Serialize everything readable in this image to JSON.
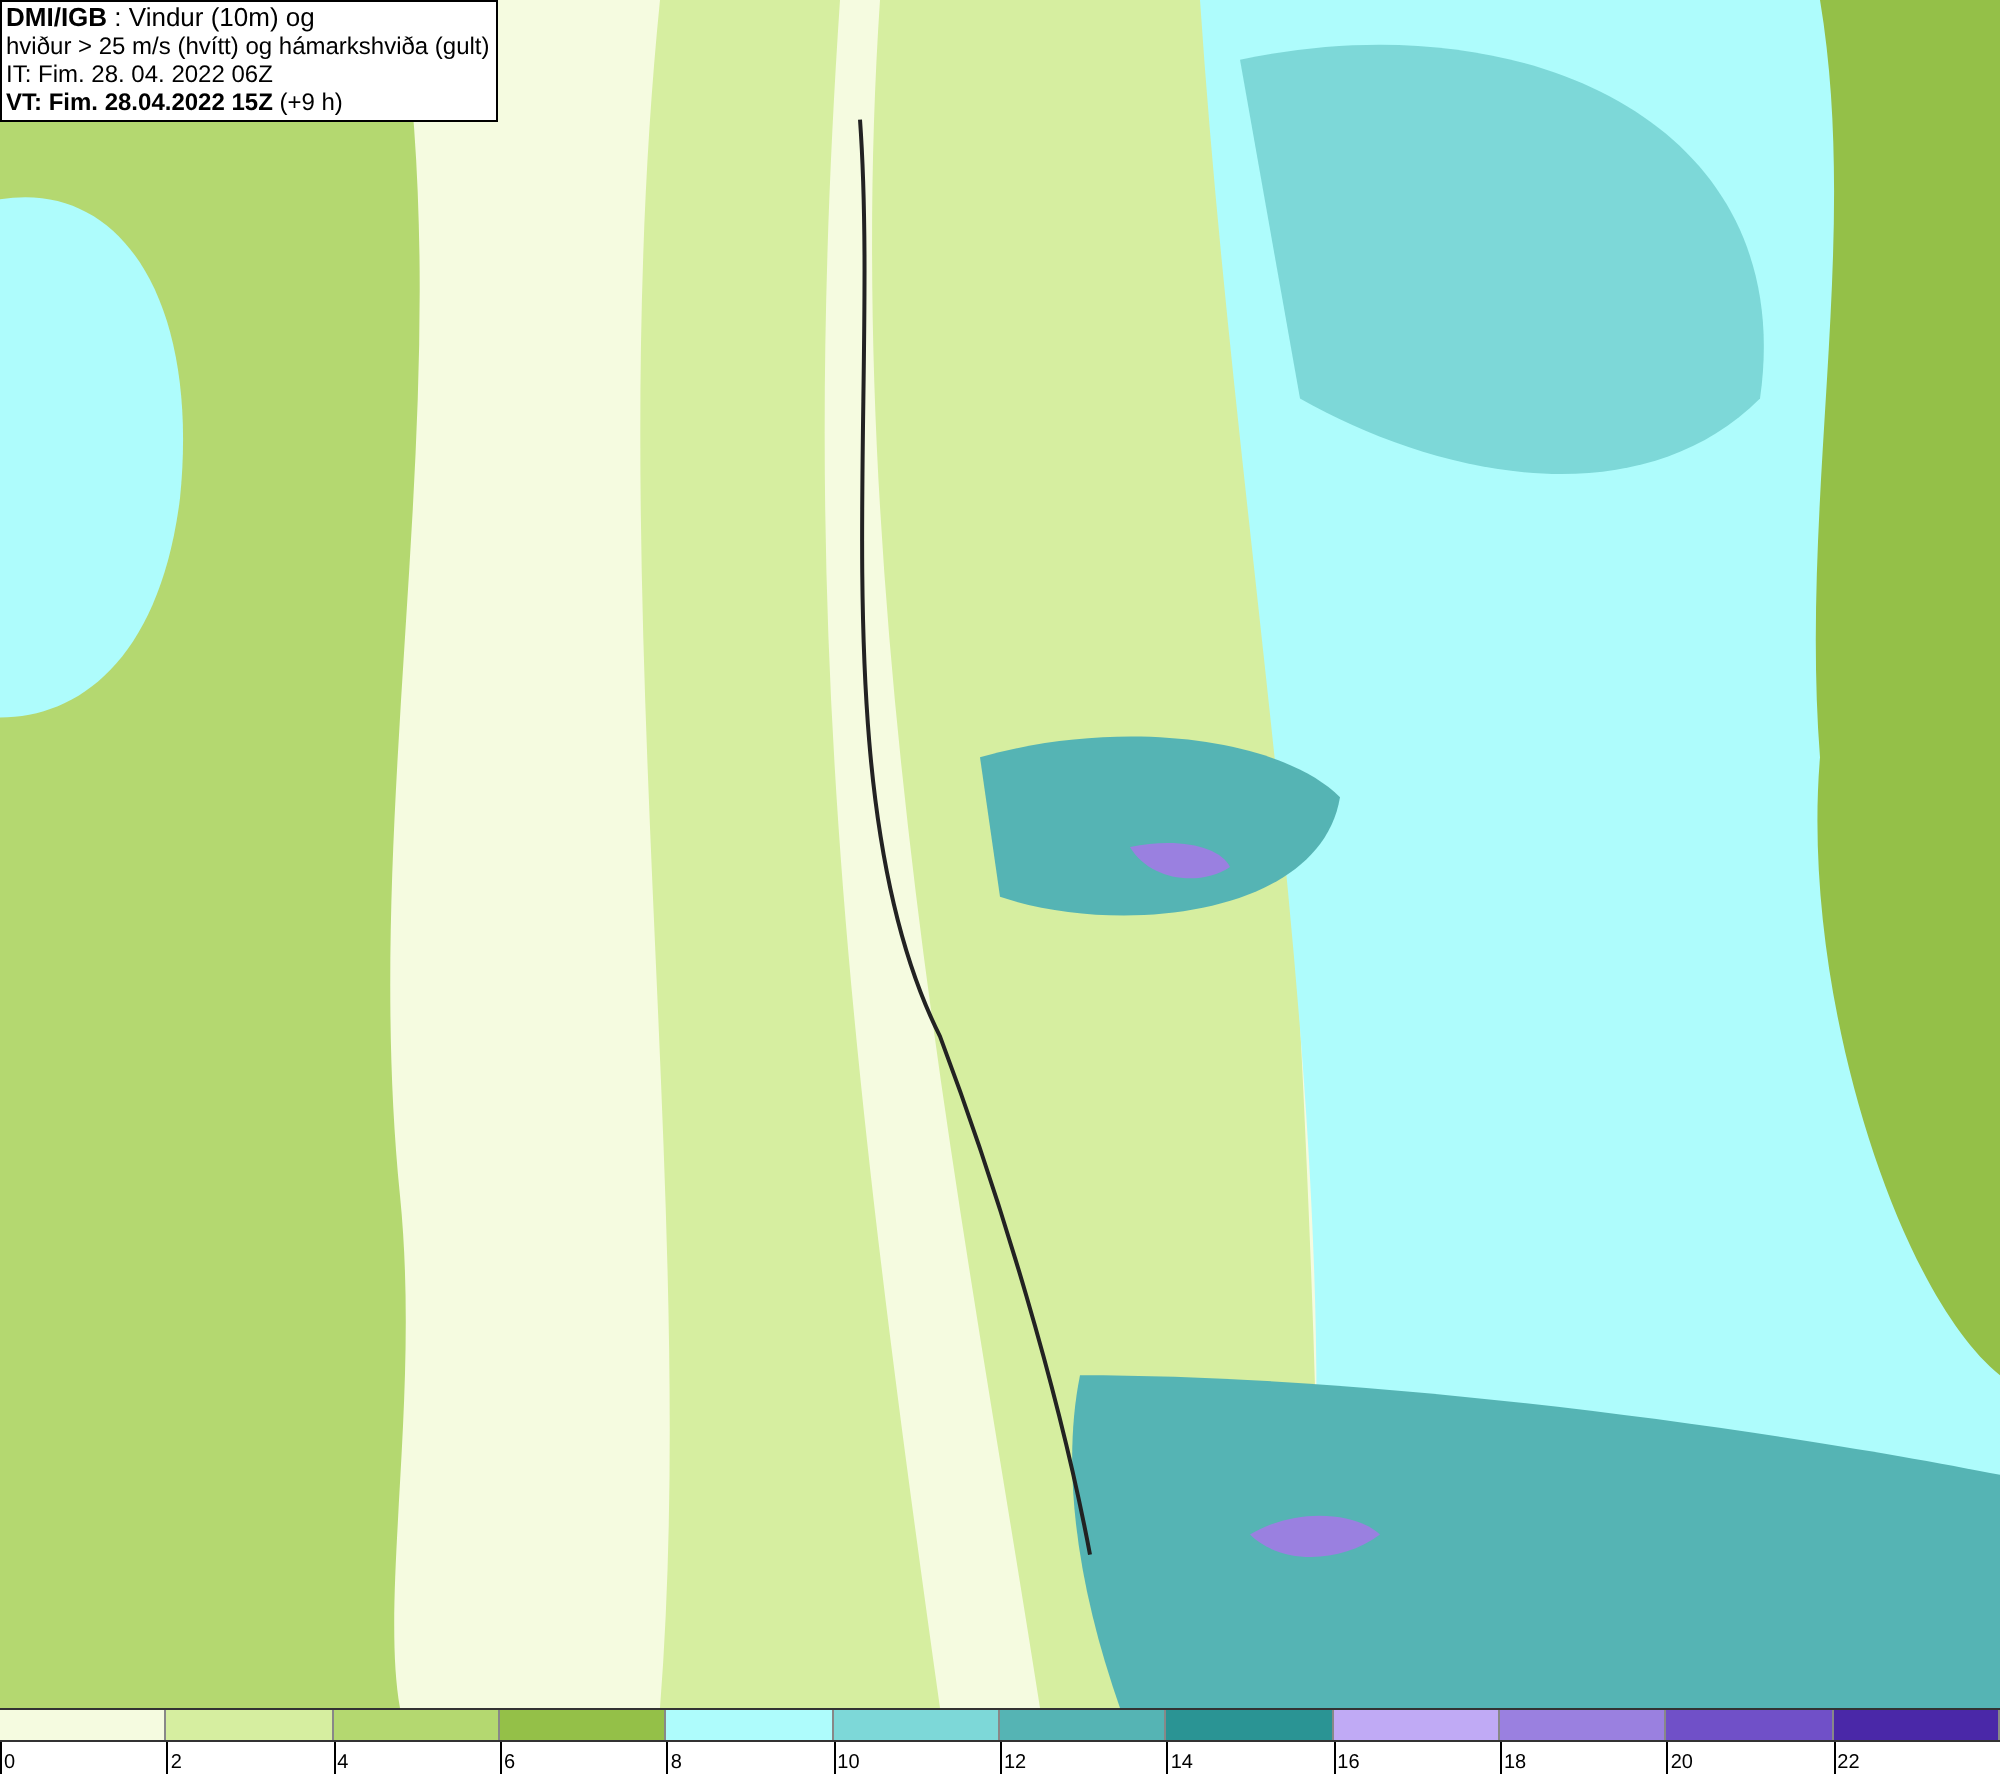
{
  "header": {
    "lines": [
      "**DMI/IGB** : Vindur (10m) og",
      "hviður > 25 m/s (hvítt) og hámarkshviða (gult)",
      "IT: Fim. 28. 04. 2022 06Z",
      "**VT: Fim. 28.04.2022 15Z** (+9 h)"
    ]
  },
  "legend": [
    {
      "label": "0",
      "color": "#f5fbe0"
    },
    {
      "label": "2",
      "color": "#d6eea0"
    },
    {
      "label": "4",
      "color": "#b4d870"
    },
    {
      "label": "6",
      "color": "#94c048"
    },
    {
      "label": "8",
      "color": "#aefcfc"
    },
    {
      "label": "10",
      "color": "#7dd8d8"
    },
    {
      "label": "12",
      "color": "#55b4b4"
    },
    {
      "label": "14",
      "color": "#2a9494"
    },
    {
      "label": "16",
      "color": "#c0aaf5"
    },
    {
      "label": "18",
      "color": "#9a80e0"
    },
    {
      "label": "20",
      "color": "#7050c8"
    },
    {
      "label": "22",
      "color": "#4a28a8"
    }
  ]
}
